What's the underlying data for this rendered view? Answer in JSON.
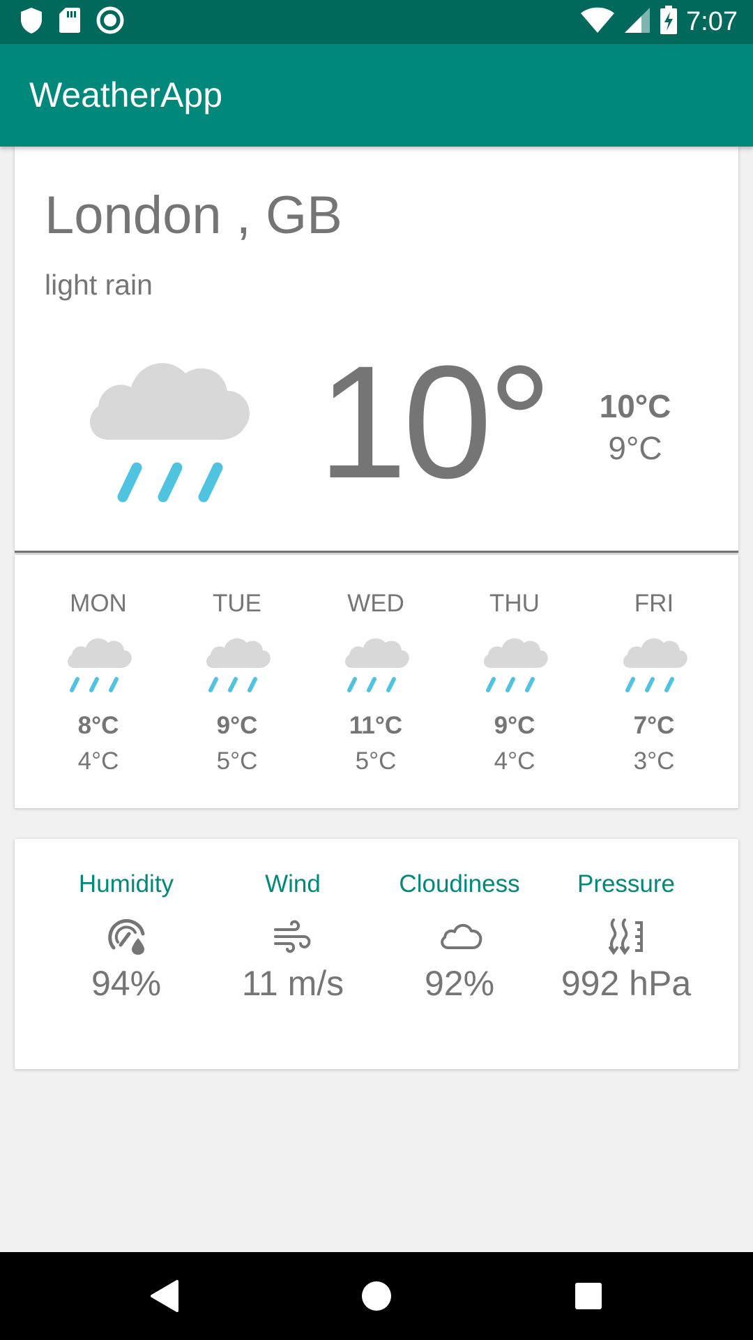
{
  "status_bar": {
    "time": "7:07",
    "icons_left": [
      "shield-icon",
      "sd-card-icon",
      "record-icon"
    ],
    "icons_right": [
      "wifi-icon",
      "signal-icon",
      "battery-charging-icon"
    ]
  },
  "app_bar": {
    "title": "WeatherApp"
  },
  "current": {
    "city": "London , GB",
    "description": "light rain",
    "temperature": "10°",
    "high": "10°C",
    "low": "9°C",
    "icon": "rain-cloud-icon"
  },
  "forecast": [
    {
      "day": "MON",
      "high": "8°C",
      "low": "4°C",
      "icon": "rain-cloud-icon"
    },
    {
      "day": "TUE",
      "high": "9°C",
      "low": "5°C",
      "icon": "rain-cloud-icon"
    },
    {
      "day": "WED",
      "high": "11°C",
      "low": "5°C",
      "icon": "rain-cloud-icon"
    },
    {
      "day": "THU",
      "high": "9°C",
      "low": "4°C",
      "icon": "rain-cloud-icon"
    },
    {
      "day": "FRI",
      "high": "7°C",
      "low": "3°C",
      "icon": "rain-cloud-icon"
    }
  ],
  "details": [
    {
      "label": "Humidity",
      "value": "94%",
      "icon": "humidity-icon"
    },
    {
      "label": "Wind",
      "value": "11 m/s",
      "icon": "wind-icon"
    },
    {
      "label": "Cloudiness",
      "value": "92%",
      "icon": "cloud-outline-icon"
    },
    {
      "label": "Pressure",
      "value": "992 hPa",
      "icon": "pressure-icon"
    }
  ],
  "colors": {
    "status_bar": "#00695c",
    "app_bar": "#00897b",
    "accent": "#00897b",
    "rain": "#4fc3e0",
    "cloud": "#d8d8d8",
    "text": "#757575"
  },
  "nav_bar": {
    "buttons": [
      "back-icon",
      "home-icon",
      "recents-icon"
    ]
  }
}
